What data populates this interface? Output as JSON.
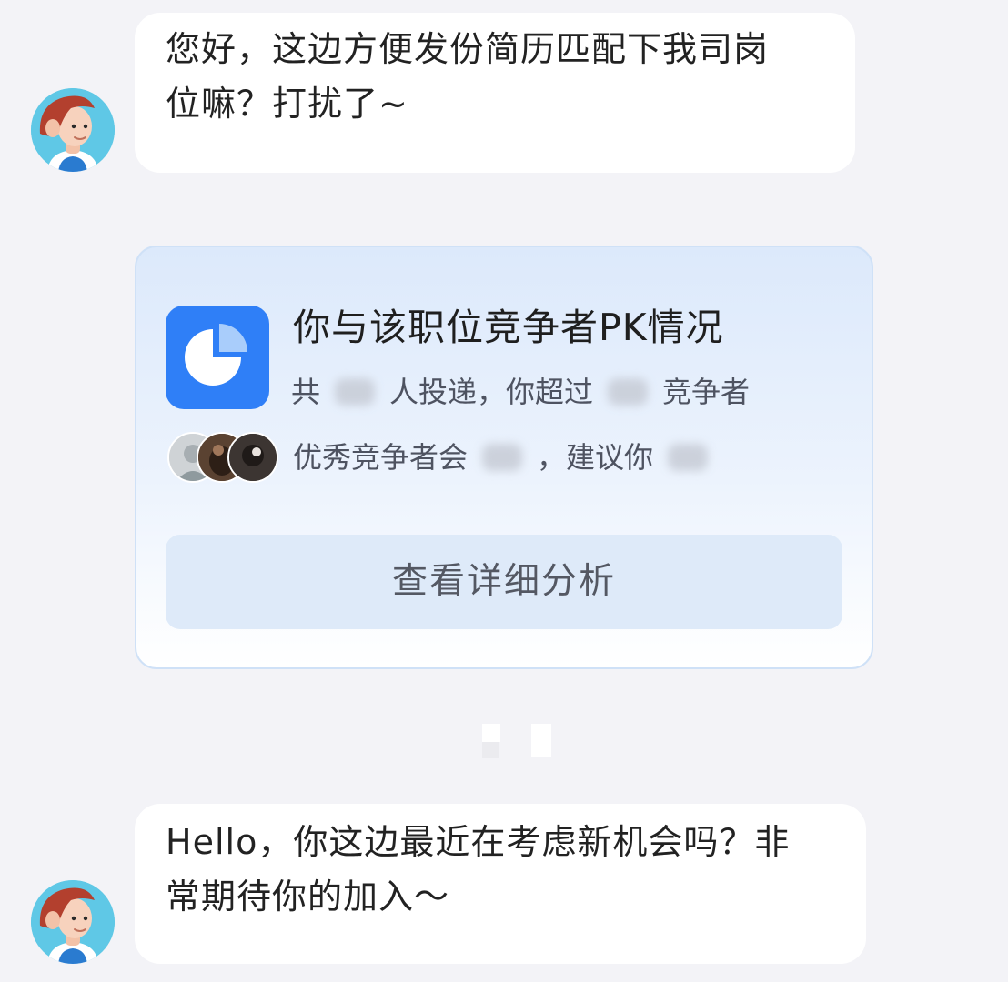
{
  "chat": {
    "messages": [
      {
        "sender": "recruiter",
        "lines": [
          "您好，这边方便发份简历匹配下我司岗",
          "位嘛？打扰了~"
        ]
      },
      {
        "sender": "recruiter",
        "lines": [
          "Hello，你这边最近在考虑新机会吗？非",
          "常期待你的加入～"
        ]
      }
    ]
  },
  "pk_card": {
    "title": "你与该职位竞争者PK情况",
    "line1": {
      "prefix": "共",
      "mid": "人投递，你超过",
      "suffix": "竞争者"
    },
    "line2": {
      "prefix": "优秀竞争者会",
      "mid": "，建议你"
    },
    "cta_label": "查看详细分析",
    "icon": "pie-chart-icon",
    "accent_color": "#2f7ff7"
  }
}
